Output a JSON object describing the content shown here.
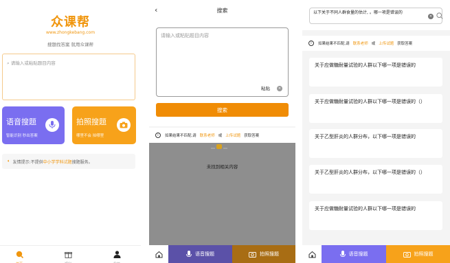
{
  "home": {
    "logo": "众课帮",
    "url": "www.zhongkebang.com",
    "slogan": "搜题找答案 就用众课帮",
    "search_placeholder": "请输入或粘贴题目内容",
    "voice_card": {
      "title": "语音搜题",
      "subtitle": "智能识别 秒出答案"
    },
    "photo_card": {
      "title": "拍照搜题",
      "subtitle": "哪里不会 拍哪里"
    },
    "tip": {
      "prefix": "友情提示:不提供",
      "highlight": "中小学学科试题",
      "suffix": "搜题服务。"
    },
    "tabs": [
      {
        "label": "首页"
      },
      {
        "label": "福利"
      },
      {
        "label": "我的"
      }
    ]
  },
  "search_page": {
    "nav_title": "搜索",
    "input_placeholder": "请输入或粘贴题目内容",
    "paste_label": "粘贴",
    "search_button": "搜索",
    "notice": {
      "prefix": "如果结果不匹配,请",
      "contact": "联系老师",
      "or": "或",
      "upload": "上传试题",
      "suffix": "获取答案"
    },
    "not_found": "未找到相关内容",
    "bottom": {
      "voice": "语音搜题",
      "photo": "拍照搜题"
    }
  },
  "results_page": {
    "query": "以下关于不同人群食量的估计, 。哪一项是错误的",
    "notice": {
      "prefix": "如果结果不匹配,请",
      "contact": "联系老师",
      "or": "或",
      "upload": "上传试题",
      "suffix": "获取答案"
    },
    "results": [
      {
        "text": "关于应做糖耐量试验的人群以下哪一项是错误的"
      },
      {
        "text": "关于应做糖耐量试验的人群以下哪一项是错误的（）"
      },
      {
        "text": "关于乙型肝炎的人群分布，以下哪一项是错误的"
      },
      {
        "text": "关于乙型肝炎的人群分布，以下哪一项是错误的（）"
      },
      {
        "text": "关于应做糖耐量试验的人群以下哪一项是错误的"
      }
    ],
    "bottom": {
      "voice": "语音搜题",
      "photo": "拍照搜题"
    }
  },
  "colors": {
    "brand_orange": "#f0960e",
    "voice_purple": "#7a6ef0",
    "photo_orange": "#f7a21a"
  }
}
